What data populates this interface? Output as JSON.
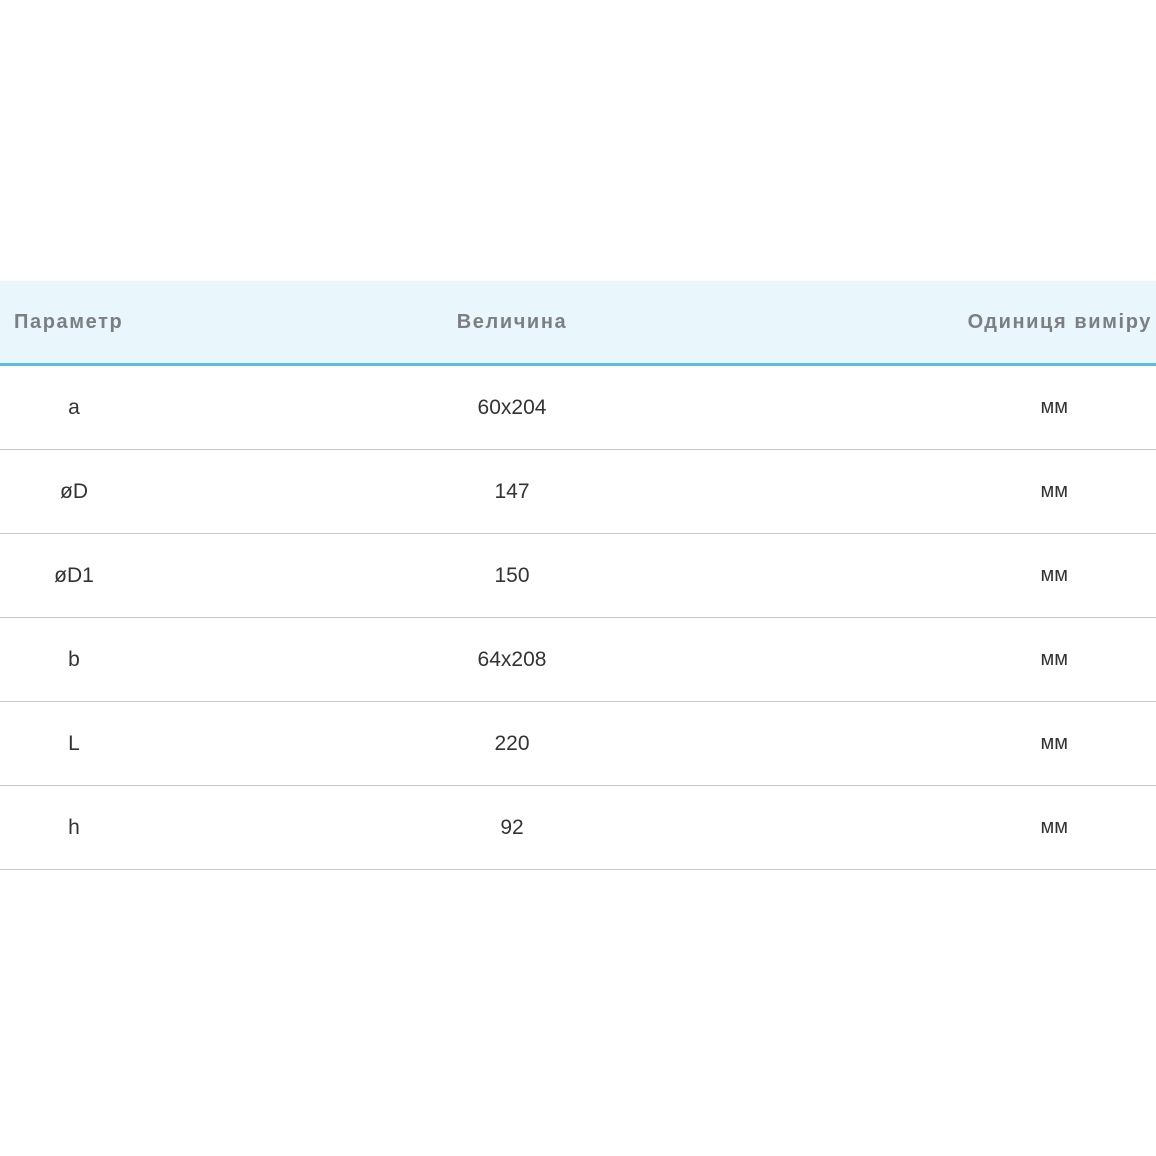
{
  "table": {
    "headers": {
      "parameter": "Параметр",
      "value": "Величина",
      "unit": "Одиниця виміру"
    },
    "rows": [
      {
        "parameter": "a",
        "value": "60x204",
        "unit": "мм"
      },
      {
        "parameter": "øD",
        "value": "147",
        "unit": "мм"
      },
      {
        "parameter": "øD1",
        "value": "150",
        "unit": "мм"
      },
      {
        "parameter": "b",
        "value": "64x208",
        "unit": "мм"
      },
      {
        "parameter": "L",
        "value": "220",
        "unit": "мм"
      },
      {
        "parameter": "h",
        "value": "92",
        "unit": "мм"
      }
    ]
  },
  "colors": {
    "header_background": "#e9f6fc",
    "header_border": "#5bbde4",
    "header_text": "#7b7f82",
    "row_text": "#333333",
    "row_divider": "#c9c9c9"
  }
}
